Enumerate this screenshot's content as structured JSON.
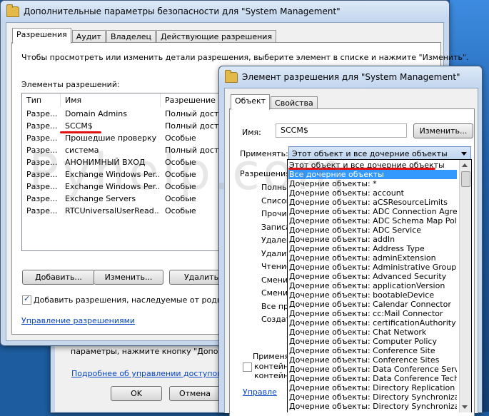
{
  "back_window": {
    "text1": "параметры, нажмите кнопку \"Дополните",
    "link": "Подробнее об управлении доступом и ра",
    "ok_label": "OK",
    "cancel_label": "Отмена"
  },
  "security_window": {
    "title": "Дополнительные параметры безопасности  для \"System Management\"",
    "tabs": [
      "Разрешения",
      "Аудит",
      "Владелец",
      "Действующие разрешения"
    ],
    "instruction": "Чтобы просмотреть или изменить детали разрешения, выберите элемент в списке и нажмите \"Изменить\".",
    "entries_label": "Элементы разрешений:",
    "columns": [
      "Тип",
      "Имя",
      "Разрешение"
    ],
    "rows": [
      {
        "type": "Разре...",
        "name": "Domain Admins",
        "perm": "Полный доступ"
      },
      {
        "type": "Разре...",
        "name": "SCCM$",
        "perm": "Полный доступ"
      },
      {
        "type": "Разре...",
        "name": "Прошедшие проверку",
        "perm": "Особые"
      },
      {
        "type": "Разре...",
        "name": "система",
        "perm": "Полный доступ"
      },
      {
        "type": "Разре...",
        "name": "АНОНИМНЫЙ ВХОД",
        "perm": "Особые"
      },
      {
        "type": "Разре...",
        "name": "Exchange Windows Per...",
        "perm": "Особые"
      },
      {
        "type": "Разре...",
        "name": "Exchange Windows Per...",
        "perm": "Особые"
      },
      {
        "type": "Разре...",
        "name": "Exchange Servers",
        "perm": "Особые"
      },
      {
        "type": "Разре...",
        "name": "RTCUniversalUserRead...",
        "perm": "Особые"
      }
    ],
    "add_label": "Добавить...",
    "edit_label": "Изменить...",
    "remove_label": "Удалить",
    "inherit_label": "Добавить разрешения, наследуемые от родительс",
    "manage_link": "Управление разрешениями"
  },
  "perm_window": {
    "title": "Элемент разрешения для \"System Management\"",
    "tabs": [
      "Объект",
      "Свойства"
    ],
    "name_label": "Имя:",
    "name_value": "SCCM$",
    "change_label": "Изменить...",
    "apply_label": "Применять:",
    "apply_value": "Этот объект и все дочерние объекты",
    "permissions_label": "Разрешения:",
    "perm_items": [
      "Полный д",
      "Список со",
      "Прочитать",
      "Записать в",
      "Удаление",
      "Удалить п",
      "Чтение ра",
      "Сменить р",
      "Сменить в",
      "Все провер",
      "Создать в"
    ],
    "apply_check_text1": "Применят",
    "apply_check_text2": "контейне",
    "apply_check_text3": "контейне",
    "manage_link": "Управле"
  },
  "dropdown": {
    "items": [
      "Этот объект и все дочерние объекты",
      "Все дочерние объекты",
      "Дочерние объекты: *",
      "Дочерние объекты: account",
      "Дочерние объекты: aCSResourceLimits",
      "Дочерние объекты: ADC Connection Agreement",
      "Дочерние объекты: ADC Schema Map Policy",
      "Дочерние объекты: ADC Service",
      "Дочерние объекты: addIn",
      "Дочерние объекты: Address Type",
      "Дочерние объекты: adminExtension",
      "Дочерние объекты: Administrative Group",
      "Дочерние объекты: Advanced Security",
      "Дочерние объекты: applicationVersion",
      "Дочерние объекты: bootableDevice",
      "Дочерние объекты: Calendar Connector",
      "Дочерние объекты: cc:Mail Connector",
      "Дочерние объекты: certificationAuthority",
      "Дочерние объекты: Chat Network",
      "Дочерние объекты: Computer Policy",
      "Дочерние объекты: Conference Site",
      "Дочерние объекты: Conference Sites",
      "Дочерние объекты: Data Conference Server (T",
      "Дочерние объекты: Data Conference Technolo",
      "Дочерние объекты: Directory Replication Conne",
      "Дочерние объекты: Directory Synchronization",
      "Дочерние объекты: Directory Synchronization"
    ],
    "selected_index": 1
  },
  "watermark": "Pyhelp.com",
  "colors": {
    "accent": "#3399ff",
    "underline": "#e01010",
    "link": "#0645c2"
  }
}
